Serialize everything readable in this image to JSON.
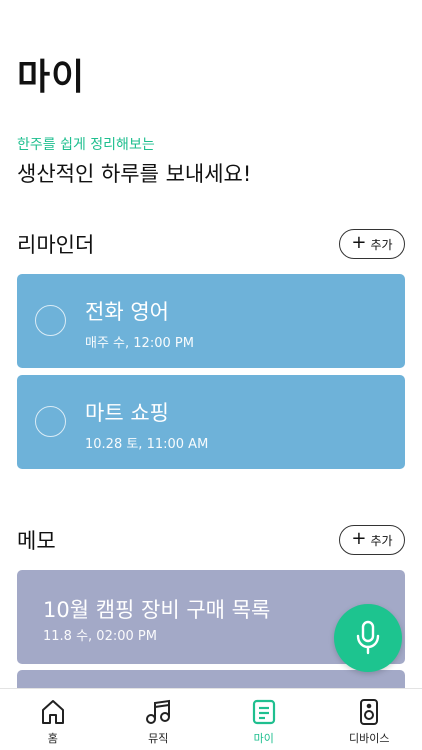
{
  "header": {
    "title": "마이"
  },
  "greeting": {
    "subtitle": "한주를 쉽게 정리해보는",
    "headline": "생산적인 하루를 보내세요!"
  },
  "reminders": {
    "title": "리마인더",
    "add_label": "추가",
    "items": [
      {
        "title": "전화 영어",
        "schedule": "매주 수, 12:00 PM"
      },
      {
        "title": "마트 쇼핑",
        "schedule": "10.28 토, 11:00 AM"
      }
    ]
  },
  "memos": {
    "title": "메모",
    "add_label": "추가",
    "items": [
      {
        "title": "10월 캠핑 장비 구매 목록",
        "date": "11.8 수, 02:00 PM"
      }
    ]
  },
  "fab": {
    "icon": "microphone-icon"
  },
  "tabbar": {
    "tabs": [
      {
        "label": "홈",
        "icon": "home-icon",
        "active": false
      },
      {
        "label": "뮤직",
        "icon": "music-note-icon",
        "active": false
      },
      {
        "label": "마이",
        "icon": "memo-icon",
        "active": true
      },
      {
        "label": "디바이스",
        "icon": "speaker-icon",
        "active": false
      }
    ]
  },
  "colors": {
    "accent": "#1fbf8f",
    "reminder_card": "#6eb2d9",
    "memo_card": "#a3a9c7"
  }
}
